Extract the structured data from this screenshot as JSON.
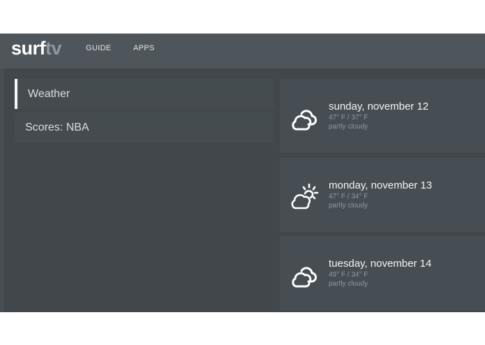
{
  "app": {
    "logo_primary": "surf",
    "logo_secondary": "tv"
  },
  "nav": {
    "guide_label": "GUIDE",
    "apps_label": "APPS"
  },
  "menu": {
    "items": [
      {
        "label": "Weather",
        "selected": true
      },
      {
        "label": "Scores: NBA",
        "selected": false
      }
    ]
  },
  "forecast": [
    {
      "date": "sunday, november 12",
      "temp": "47° F / 37° F",
      "condition": "partly cloudy",
      "icon": "cloud-icon"
    },
    {
      "date": "monday, november 13",
      "temp": "47° F / 34° F",
      "condition": "partly cloudy",
      "icon": "sun-cloud-icon"
    },
    {
      "date": "tuesday, november 14",
      "temp": "49° F / 34° F",
      "condition": "partly cloudy",
      "icon": "cloud-icon"
    }
  ],
  "colors": {
    "background": "#41474b",
    "topbar": "#4f565b",
    "accent_logo": "#8d98a2",
    "selected_bar": "#f4f6f7"
  }
}
